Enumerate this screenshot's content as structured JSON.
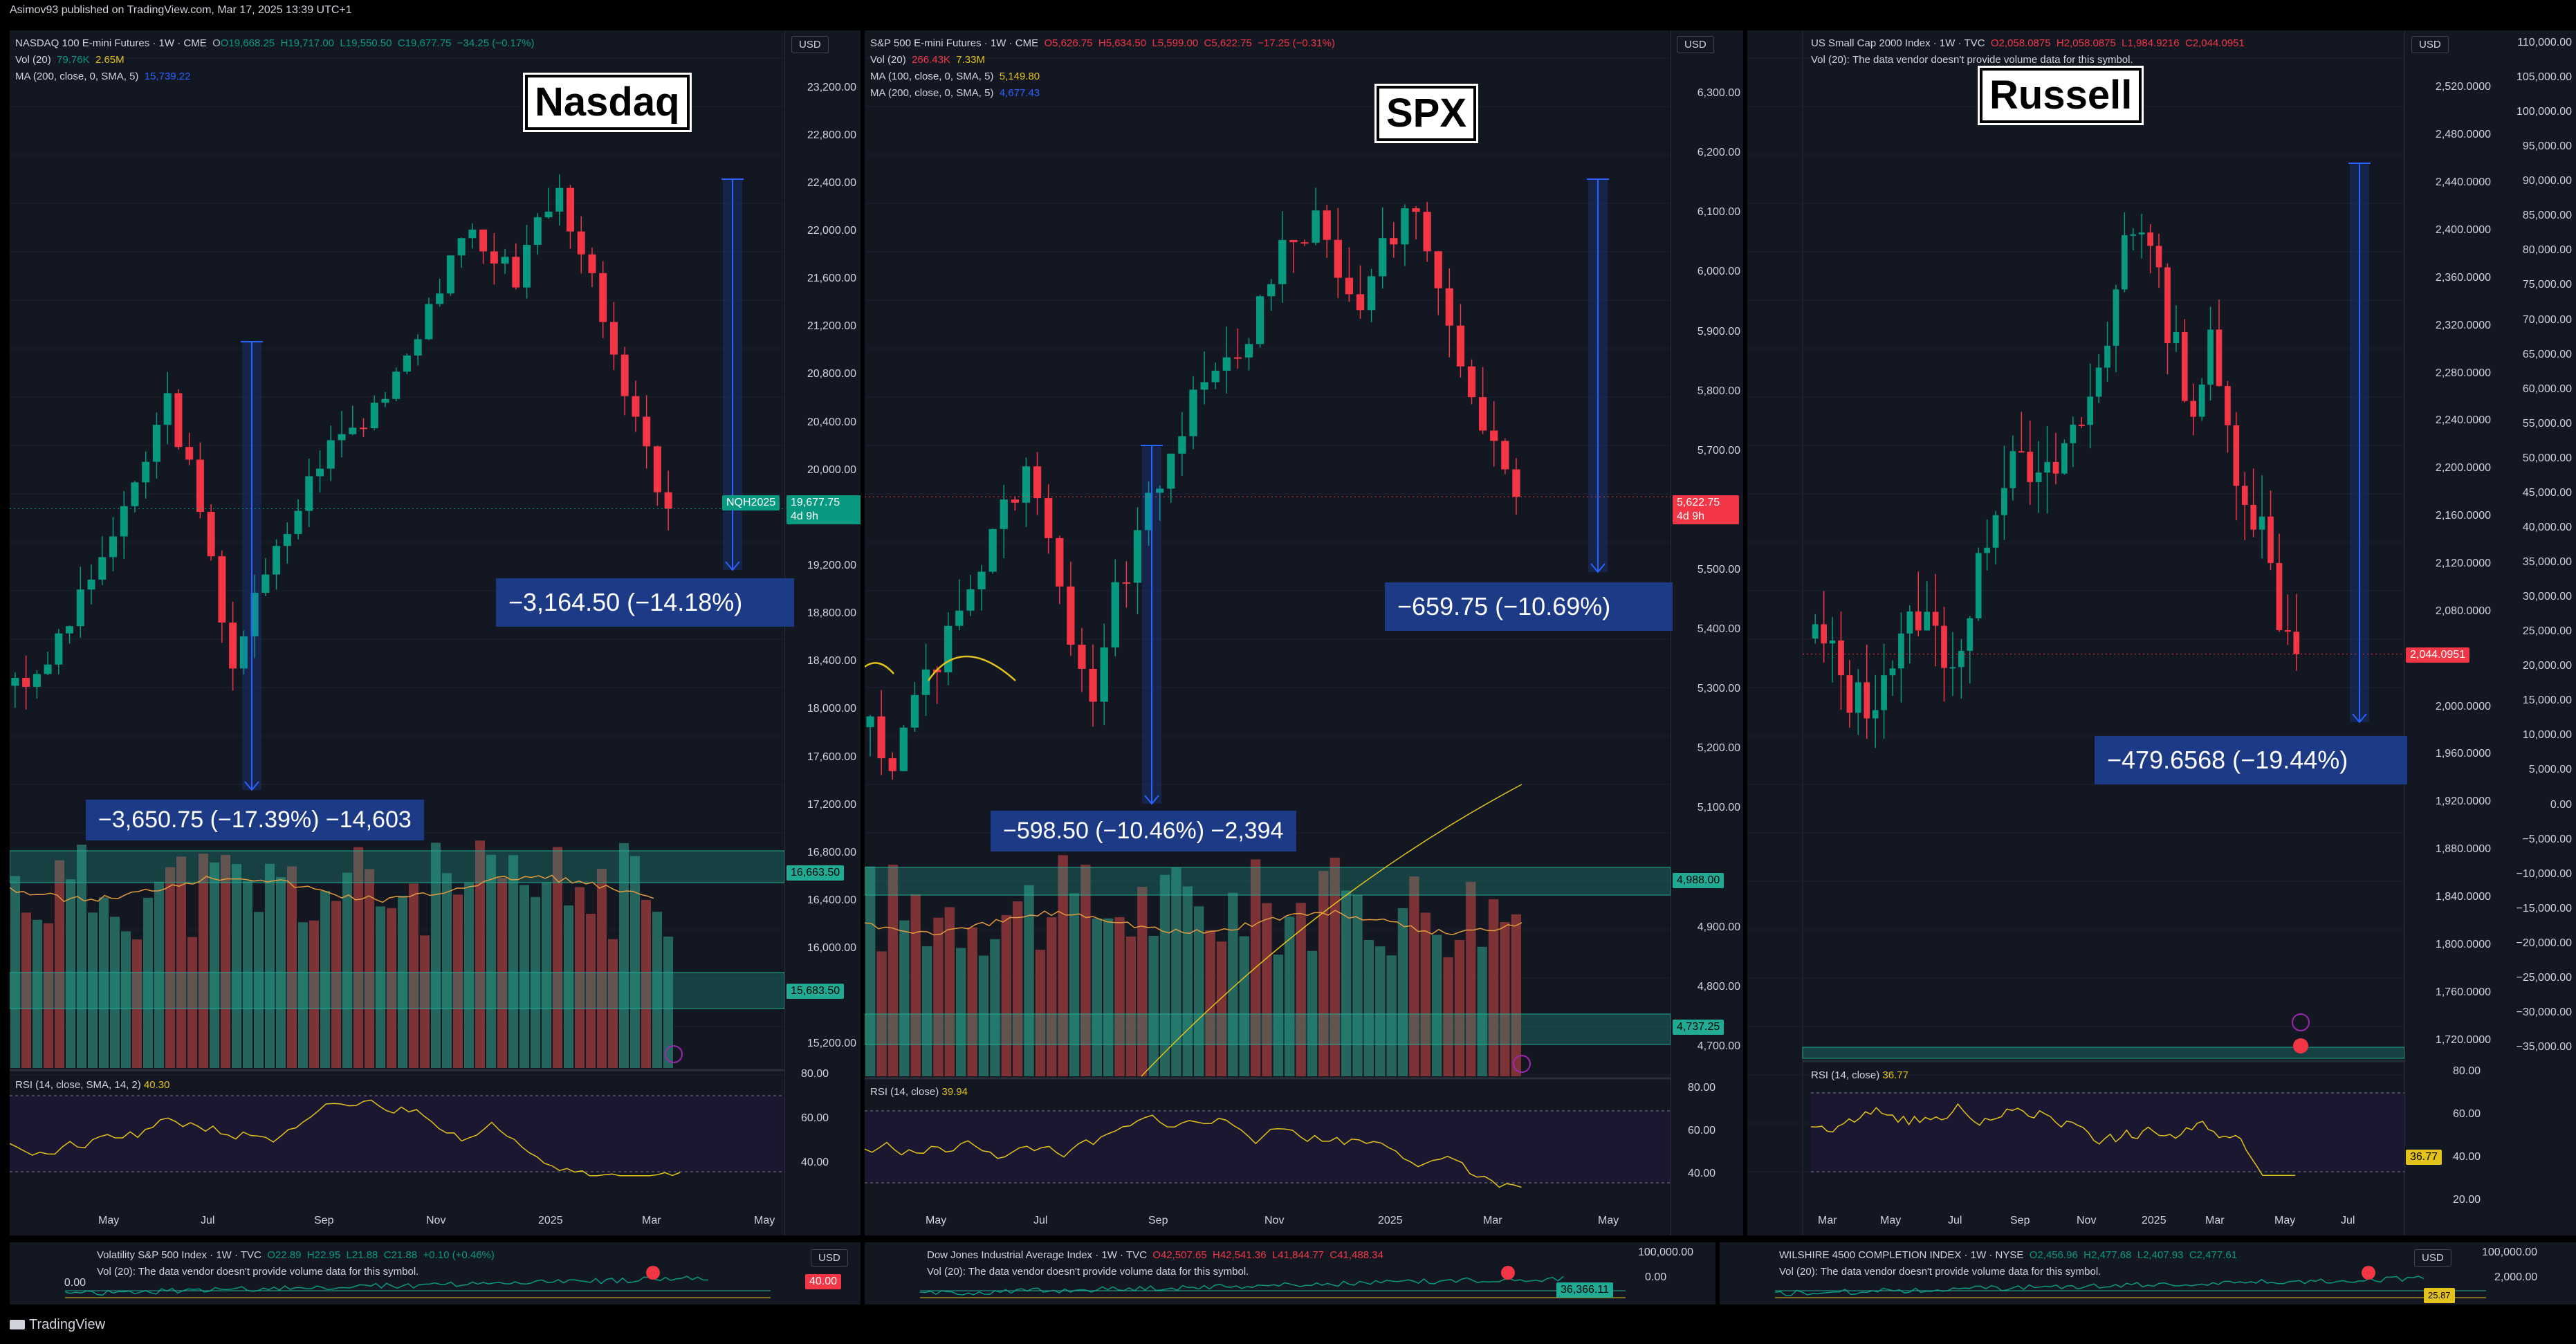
{
  "header": {
    "published": "Asimov93 published on TradingView.com, Mar 17, 2025 13:39 UTC+1"
  },
  "footer": {
    "brand": "TradingView"
  },
  "currency": "USD",
  "panels": {
    "nasdaq": {
      "title_box": "Nasdaq",
      "symbol_line": {
        "name": "NASDAQ 100 E-mini Futures · 1W · CME",
        "o": "O19,668.25",
        "h": "H19,717.00",
        "l": "L19,550.50",
        "c": "C19,677.75",
        "chg": "−34.25 (−0.17%)"
      },
      "vol_line": {
        "label": "Vol (20)",
        "v1": "79.76K",
        "v2": "2.65M"
      },
      "ma_lines": [
        {
          "label": "MA (200, close, 0, SMA, 5)",
          "value": "15,739.22"
        }
      ],
      "y_ticks": [
        "23,200.00",
        "22,800.00",
        "22,400.00",
        "22,000.00",
        "21,600.00",
        "21,200.00",
        "20,800.00",
        "20,400.00",
        "20,000.00",
        "19,200.00",
        "18,800.00",
        "18,400.00",
        "18,000.00",
        "17,600.00",
        "17,200.00",
        "16,800.00",
        "16,400.00",
        "16,000.00",
        "15,200.00"
      ],
      "price_tag": {
        "symbol": "NQH2025",
        "price": "19,677.75",
        "time": "4d 9h"
      },
      "zone_tags": [
        "16,663.50",
        "15,683.50"
      ],
      "x_ticks": [
        "May",
        "Jul",
        "Sep",
        "Nov",
        "2025",
        "Mar",
        "May"
      ],
      "measure_big": "−3,164.50 (−14.18%)",
      "measure_small": "−3,650.75 (−17.39%) −14,603",
      "rsi": {
        "label": "RSI (14, close, SMA, 14, 2)",
        "value": "40.30",
        "ticks": [
          "80.00",
          "60.00",
          "40.00"
        ]
      }
    },
    "spx": {
      "title_box": "SPX",
      "symbol_line": {
        "name": "S&P 500 E-mini Futures · 1W · CME",
        "o": "O5,626.75",
        "h": "H5,634.50",
        "l": "L5,599.00",
        "c": "C5,622.75",
        "chg": "−17.25 (−0.31%)"
      },
      "vol_line": {
        "label": "Vol (20)",
        "v1": "266.43K",
        "v2": "7.33M"
      },
      "ma_lines": [
        {
          "label": "MA (100, close, 0, SMA, 5)",
          "value": "5,149.80"
        },
        {
          "label": "MA (200, close, 0, SMA, 5)",
          "value": "4,677.43"
        }
      ],
      "y_ticks": [
        "6,300.00",
        "6,200.00",
        "6,100.00",
        "6,000.00",
        "5,900.00",
        "5,800.00",
        "5,700.00",
        "5,500.00",
        "5,400.00",
        "5,300.00",
        "5,200.00",
        "5,100.00",
        "4,900.00",
        "4,800.00",
        "4,700.00"
      ],
      "price_tag": {
        "price": "5,622.75",
        "time": "4d 9h"
      },
      "zone_tags": [
        "4,988.00",
        "4,737.25"
      ],
      "x_ticks": [
        "May",
        "Jul",
        "Sep",
        "Nov",
        "2025",
        "Mar",
        "May"
      ],
      "measure_big": "−659.75 (−10.69%)",
      "measure_small": "−598.50 (−10.46%) −2,394",
      "rsi": {
        "label": "RSI (14, close)",
        "value": "39.94",
        "ticks": [
          "80.00",
          "60.00",
          "40.00"
        ]
      }
    },
    "russell": {
      "title_box": "Russell",
      "symbol_line": {
        "name": "US Small Cap 2000 Index · 1W · TVC",
        "o": "O2,058.0875",
        "h": "H2,058.0875",
        "l": "L1,984.9216",
        "c": "C2,044.0951"
      },
      "vol_line": {
        "label": "Vol (20)",
        "note": "The data vendor doesn't provide volume data for this symbol."
      },
      "y_ticks_left": [
        "2,520.0000",
        "2,480.0000",
        "2,440.0000",
        "2,400.0000",
        "2,360.0000",
        "2,320.0000",
        "2,280.0000",
        "2,240.0000",
        "2,200.0000",
        "2,160.0000",
        "2,120.0000",
        "2,080.0000",
        "2,000.0000",
        "1,960.0000",
        "1,920.0000",
        "1,880.0000",
        "1,840.0000",
        "1,800.0000",
        "1,760.0000",
        "1,720.0000"
      ],
      "y_ticks_right": [
        "110,000.00",
        "105,000.00",
        "100,000.00",
        "95,000.00",
        "90,000.00",
        "85,000.00",
        "80,000.00",
        "75,000.00",
        "70,000.00",
        "65,000.00",
        "60,000.00",
        "55,000.00",
        "50,000.00",
        "45,000.00",
        "40,000.00",
        "35,000.00",
        "30,000.00",
        "25,000.00",
        "20,000.00",
        "15,000.00",
        "10,000.00",
        "5,000.00",
        "0.00",
        "−5,000.00",
        "−10,000.00",
        "−15,000.00",
        "−20,000.00",
        "−25,000.00",
        "−30,000.00",
        "−35,000.00"
      ],
      "price_tag": {
        "price": "2,044.0951"
      },
      "x_ticks": [
        "Mar",
        "May",
        "Jul",
        "Sep",
        "Nov",
        "2025",
        "Mar",
        "May",
        "Jul"
      ],
      "measure_big": "−479.6568 (−19.44%)",
      "rsi": {
        "label": "RSI (14, close)",
        "value": "36.77",
        "ticks": [
          "80.00",
          "60.00",
          "40.00",
          "20.00"
        ]
      }
    }
  },
  "mini_panels": [
    {
      "title": "Volatility S&P 500 Index · 1W · TVC",
      "o": "O22.89",
      "h": "H22.95",
      "l": "L21.88",
      "c": "C21.88",
      "chg": "+0.10 (+0.46%)",
      "vol_note": "Vol (20): The data vendor doesn't provide volume data for this symbol.",
      "axis": [
        "0.00"
      ],
      "tag": "40.00"
    },
    {
      "title": "Dow Jones Industrial Average Index · 1W · TVC",
      "o": "O42,507.65",
      "h": "H42,541.36",
      "l": "L41,844.77",
      "c": "C41,488.34",
      "vol_note": "Vol (20): The data vendor doesn't provide volume data for this symbol.",
      "axis": [
        "100,000.00",
        "0.00"
      ],
      "tag": "36,366.11"
    },
    {
      "title": "WILSHIRE 4500 COMPLETION INDEX · 1W · NYSE",
      "o": "O2,456.96",
      "h": "H2,477.68",
      "l": "L2,407.93",
      "c": "C2,477.61",
      "vol_note": "Vol (20): The data vendor doesn't provide volume data for this symbol.",
      "axis": [
        "100,000.00",
        "2,000.00"
      ],
      "tag": "25.87"
    }
  ],
  "chart_data": [
    {
      "type": "candlestick",
      "title": "NASDAQ 100 E-mini Futures · 1W · CME",
      "timeframe": "1W",
      "ylim": [
        15000,
        23400
      ],
      "x_range": [
        "2024-04",
        "2025-05"
      ],
      "close_path_approx": [
        18300,
        18200,
        18600,
        18900,
        19300,
        19600,
        20100,
        20600,
        20000,
        19200,
        18400,
        18900,
        19300,
        19700,
        20100,
        20300,
        20400,
        20700,
        21000,
        21400,
        21700,
        22000,
        21800,
        21600,
        22100,
        22300,
        21900,
        21200,
        20600,
        20100,
        19700
      ],
      "last": 19677.75,
      "colors": {
        "up": "#089981",
        "down": "#f23645"
      }
    },
    {
      "type": "candlestick",
      "title": "S&P 500 E-mini Futures · 1W · CME",
      "timeframe": "1W",
      "ylim": [
        4650,
        6350
      ],
      "x_range": [
        "2024-04",
        "2025-05"
      ],
      "close_path_approx": [
        5250,
        5150,
        5300,
        5350,
        5450,
        5500,
        5600,
        5650,
        5550,
        5350,
        5300,
        5450,
        5550,
        5650,
        5750,
        5800,
        5850,
        5900,
        6000,
        6050,
        6100,
        6000,
        5950,
        6050,
        6100,
        6050,
        5900,
        5800,
        5700,
        5620
      ],
      "last": 5622.75,
      "colors": {
        "up": "#089981",
        "down": "#f23645"
      }
    },
    {
      "type": "candlestick",
      "title": "US Small Cap 2000 Index · 1W · TVC",
      "timeframe": "1W",
      "ylim": [
        1700,
        2540
      ],
      "x_range": [
        "2024-03",
        "2025-07"
      ],
      "close_path_approx": [
        2060,
        2040,
        2010,
        2000,
        2030,
        2050,
        2080,
        2060,
        2040,
        2070,
        2150,
        2200,
        2230,
        2180,
        2200,
        2220,
        2260,
        2300,
        2400,
        2410,
        2350,
        2300,
        2250,
        2300,
        2230,
        2180,
        2150,
        2080,
        2044
      ],
      "last": 2044.0951,
      "colors": {
        "up": "#089981",
        "down": "#f23645"
      }
    }
  ]
}
